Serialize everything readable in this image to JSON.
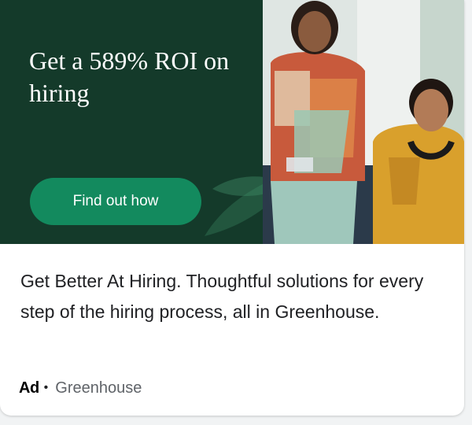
{
  "banner": {
    "headline": "Get a 589% ROI on hiring",
    "cta_label": "Find out how",
    "background_color": "#143a2a",
    "cta_color": "#138a5e",
    "photo_icon": "two-people-photo"
  },
  "description": "Get Better At Hiring. Thoughtful solutions for every step of the hiring process, all in Greenhouse.",
  "footer": {
    "ad_label": "Ad",
    "separator": "•",
    "advertiser": "Greenhouse"
  }
}
